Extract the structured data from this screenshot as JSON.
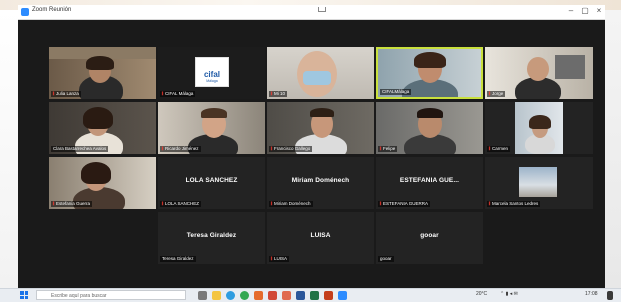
{
  "window": {
    "title": "Zoom Reunión",
    "controls": {
      "minimize": "–",
      "maximize": "▢",
      "close": "×"
    }
  },
  "participants": [
    {
      "name": "Julia Lanza",
      "video": true,
      "muted": true
    },
    {
      "name": "CIFAL Málaga",
      "video": true,
      "muted": true,
      "logo": "cifal",
      "logo_sub": "Málaga"
    },
    {
      "name": "Mi 10",
      "video": true,
      "muted": true
    },
    {
      "name": "CIFALMálaga",
      "video": true,
      "muted": false,
      "active_speaker": true
    },
    {
      "name": "Jorge",
      "video": true,
      "muted": true
    },
    {
      "name": "Clara Bastarrechea Avalos",
      "video": true,
      "muted": false
    },
    {
      "name": "Ricardo Jiménez",
      "video": true,
      "muted": true
    },
    {
      "name": "Francisco Gallego",
      "video": true,
      "muted": true
    },
    {
      "name": "Felipe",
      "video": true,
      "muted": true
    },
    {
      "name": "Carmen",
      "video": true,
      "muted": true
    },
    {
      "name": "Estefania Guerra",
      "video": true,
      "muted": true
    },
    {
      "name": "LOLA SANCHEZ",
      "display": "LOLA SANCHEZ",
      "video": false,
      "muted": true
    },
    {
      "name": "Miriam Doménech",
      "display": "Miriam Doménech",
      "video": false,
      "muted": true
    },
    {
      "name": "ESTEFANIA GUERRA",
      "display": "ESTEFANIA GUE...",
      "video": false,
      "muted": true
    },
    {
      "name": "Marcela Santos Ledres",
      "video": true,
      "muted": true
    },
    {
      "name": "Teresa Giraldez",
      "display": "Teresa Giraldez",
      "video": false,
      "muted": false
    },
    {
      "name": "LUISA",
      "display": "LUISA",
      "video": false,
      "muted": true
    },
    {
      "name": "gooar",
      "display": "gooar",
      "video": false,
      "muted": false
    }
  ],
  "taskbar": {
    "search_placeholder": "Escribe aquí para buscar",
    "temperature": "20°C",
    "time": "17:08",
    "icons": [
      "task-view-icon",
      "file-explorer-icon",
      "edge-icon",
      "chrome-icon",
      "store-icon",
      "mail-icon",
      "photos-icon",
      "word-icon",
      "excel-icon",
      "powerpoint-icon",
      "zoom-icon"
    ]
  },
  "colors": {
    "window_bg": "#1a1a1a",
    "tile_bg": "#232323",
    "active_border": "#c9e03d",
    "mute": "#ff3b30",
    "taskbar": "#e9edf2"
  }
}
